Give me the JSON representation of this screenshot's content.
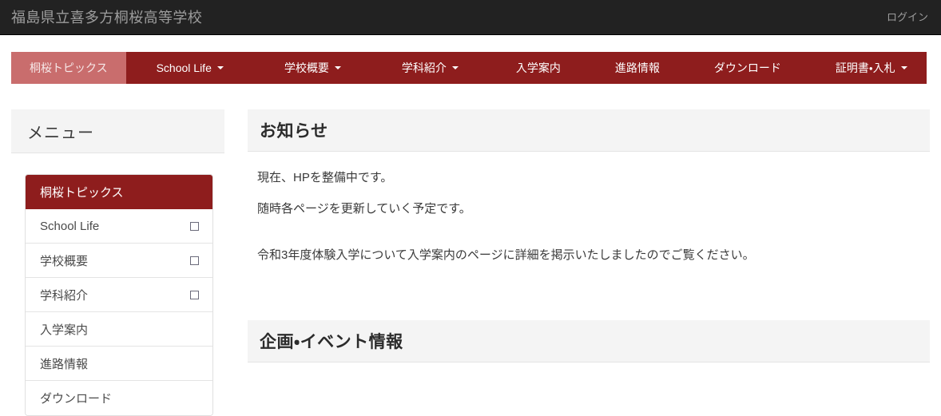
{
  "topbar": {
    "site_title": "福島県立喜多方桐桜高等学校",
    "login_label": "ログイン"
  },
  "nav": {
    "items": [
      {
        "label": "桐桜トピックス",
        "has_caret": false,
        "active": true
      },
      {
        "label": "School Life",
        "has_caret": true,
        "active": false
      },
      {
        "label": "学校概要",
        "has_caret": true,
        "active": false
      },
      {
        "label": "学科紹介",
        "has_caret": true,
        "active": false
      },
      {
        "label": "入学案内",
        "has_caret": false,
        "active": false
      },
      {
        "label": "進路情報",
        "has_caret": false,
        "active": false
      },
      {
        "label": "ダウンロード",
        "has_caret": false,
        "active": false
      },
      {
        "label": "証明書・入札",
        "has_caret": true,
        "active": false
      }
    ]
  },
  "sidebar": {
    "header_title": "メニュー",
    "items": [
      {
        "label": "桐桜トピックス",
        "active": true,
        "box": false
      },
      {
        "label": "School Life",
        "active": false,
        "box": true
      },
      {
        "label": "学校概要",
        "active": false,
        "box": true
      },
      {
        "label": "学科紹介",
        "active": false,
        "box": true
      },
      {
        "label": "入学案内",
        "active": false,
        "box": false
      },
      {
        "label": "進路情報",
        "active": false,
        "box": false
      },
      {
        "label": "ダウンロード",
        "active": false,
        "box": false
      }
    ]
  },
  "main": {
    "notice": {
      "heading": "お知らせ",
      "paragraphs": [
        "現在、HPを整備中です。",
        "随時各ページを更新していく予定です。",
        "令和3年度体験入学について入学案内のページに詳細を掲示いたしましたのでご覧ください。"
      ]
    },
    "events": {
      "heading": "企画・イベント情報"
    }
  },
  "colors": {
    "topbar_bg": "#222222",
    "nav_bg": "#8e1d1d",
    "nav_active_bg": "#c96d6d",
    "sidebar_active_bg": "#8e1d1d",
    "panel_header_bg": "#f4f4f4"
  }
}
